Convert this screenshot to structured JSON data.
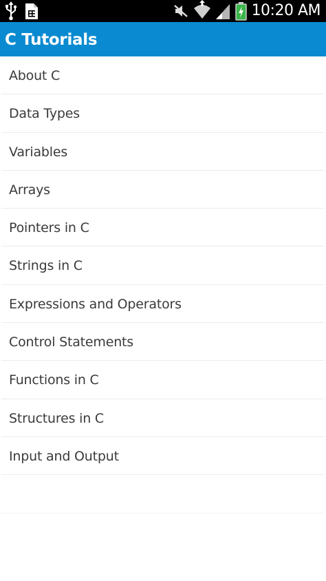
{
  "status_bar": {
    "time": "10:20 AM",
    "icons": [
      "usb-icon",
      "sd-card-icon",
      "mute-icon",
      "wifi-icon",
      "signal-icon",
      "battery-charging-icon"
    ]
  },
  "action_bar": {
    "title": "C Tutorials",
    "color": "#0a8ad0"
  },
  "topics": [
    {
      "label": "About C"
    },
    {
      "label": "Data Types"
    },
    {
      "label": "Variables"
    },
    {
      "label": "Arrays"
    },
    {
      "label": "Pointers in C"
    },
    {
      "label": "Strings in C"
    },
    {
      "label": "Expressions and Operators"
    },
    {
      "label": "Control Statements"
    },
    {
      "label": "Functions in C"
    },
    {
      "label": "Structures in C"
    },
    {
      "label": "Input and Output"
    }
  ]
}
